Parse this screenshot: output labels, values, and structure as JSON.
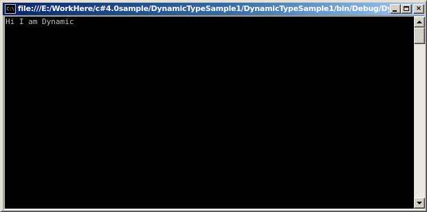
{
  "window": {
    "title": "file:///E:/WorkHere/c#4.0sample/DynamicTypeSample1/DynamicTypeSample1/bin/Debug/Dynamic...",
    "icon_label": "C:\\",
    "icon_name": "console-app-icon",
    "buttons": {
      "minimize_icon": "minimize-icon",
      "maximize_icon": "maximize-icon",
      "close_icon": "close-icon",
      "close_glyph": "×"
    }
  },
  "console": {
    "lines": [
      "Hi I am Dynamic"
    ],
    "background": "#000000",
    "foreground": "#c0c0c0"
  },
  "scrollbar": {
    "up_icon": "arrow-up-icon",
    "down_icon": "arrow-down-icon",
    "position": 0
  }
}
